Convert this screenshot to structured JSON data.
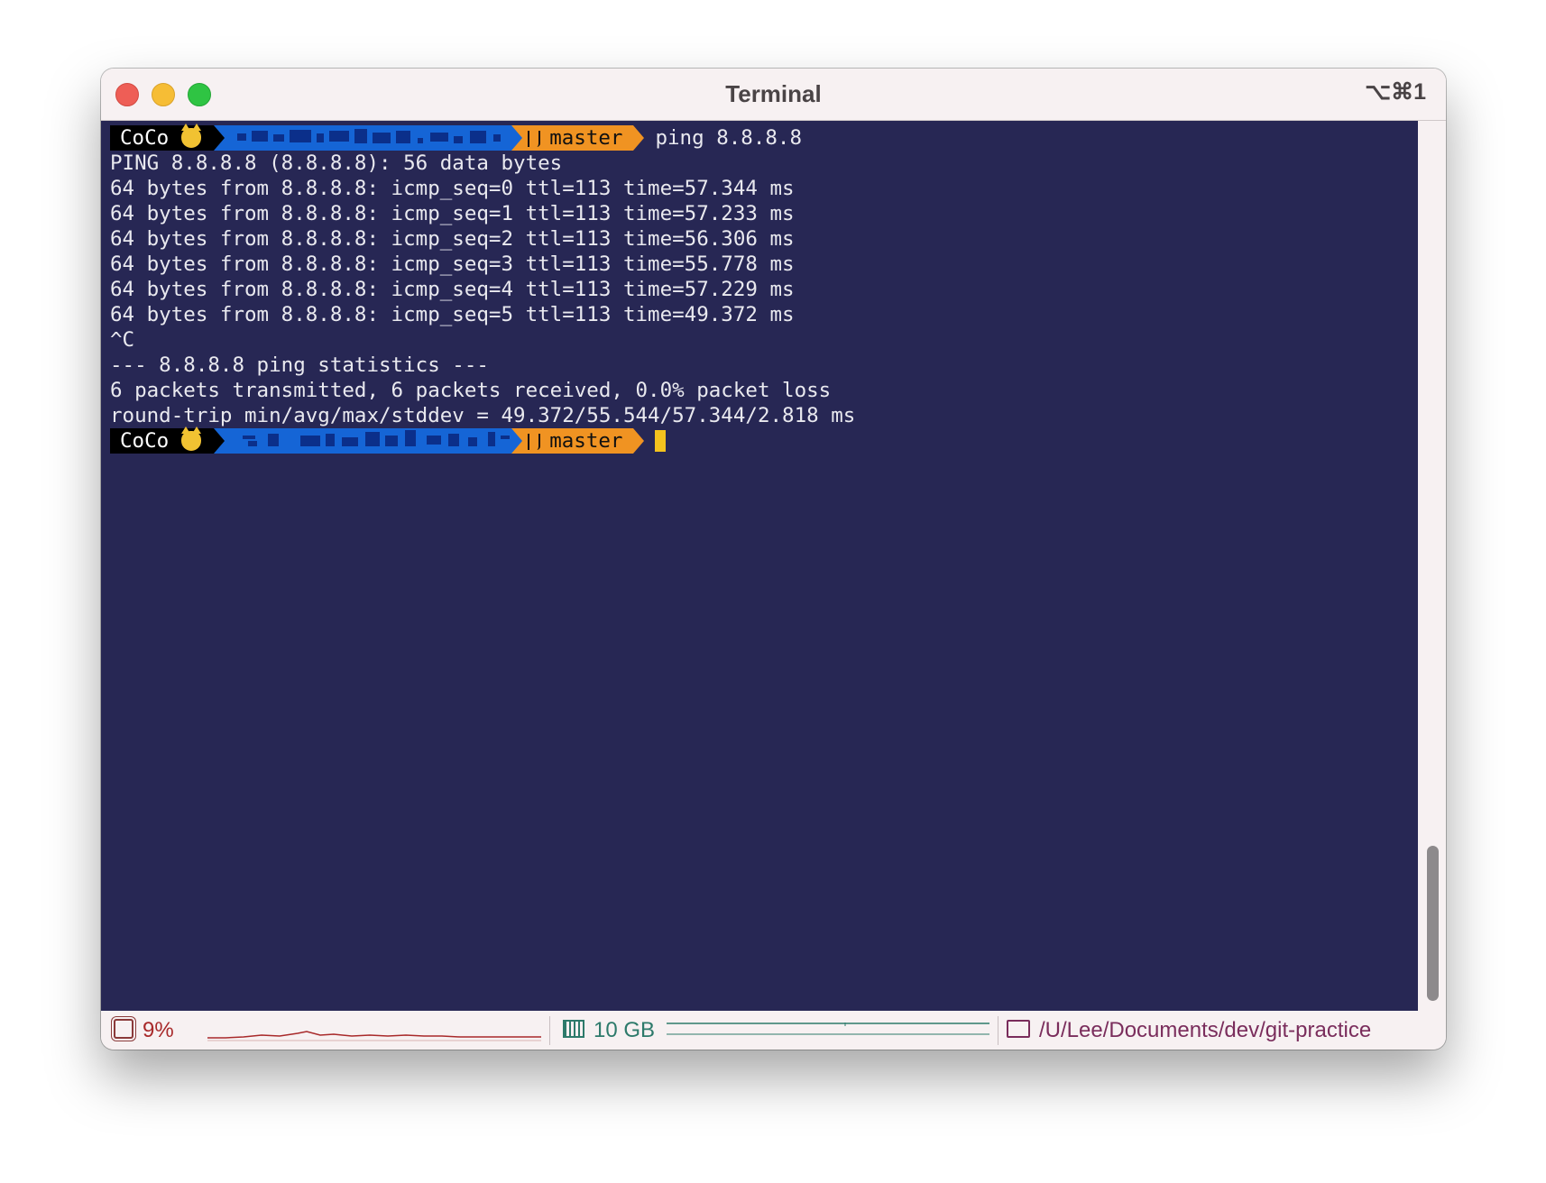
{
  "window": {
    "title": "Terminal",
    "shortcut": "⌥⌘1"
  },
  "prompt": {
    "user": "CoCo",
    "branch": "master",
    "command": "ping 8.8.8.8"
  },
  "output": [
    "PING 8.8.8.8 (8.8.8.8): 56 data bytes",
    "64 bytes from 8.8.8.8: icmp_seq=0 ttl=113 time=57.344 ms",
    "64 bytes from 8.8.8.8: icmp_seq=1 ttl=113 time=57.233 ms",
    "64 bytes from 8.8.8.8: icmp_seq=2 ttl=113 time=56.306 ms",
    "64 bytes from 8.8.8.8: icmp_seq=3 ttl=113 time=55.778 ms",
    "64 bytes from 8.8.8.8: icmp_seq=4 ttl=113 time=57.229 ms",
    "64 bytes from 8.8.8.8: icmp_seq=5 ttl=113 time=49.372 ms",
    "^C",
    "--- 8.8.8.8 ping statistics ---",
    "6 packets transmitted, 6 packets received, 0.0% packet loss",
    "round-trip min/avg/max/stddev = 49.372/55.544/57.344/2.818 ms"
  ],
  "status": {
    "cpu": "9%",
    "memory": "10 GB",
    "directory": "/U/Lee/Documents/dev/git-practice"
  },
  "colors": {
    "terminal_bg": "#272754",
    "path_segment": "#1565d6",
    "git_segment": "#f09322",
    "cursor": "#f4c21e"
  }
}
